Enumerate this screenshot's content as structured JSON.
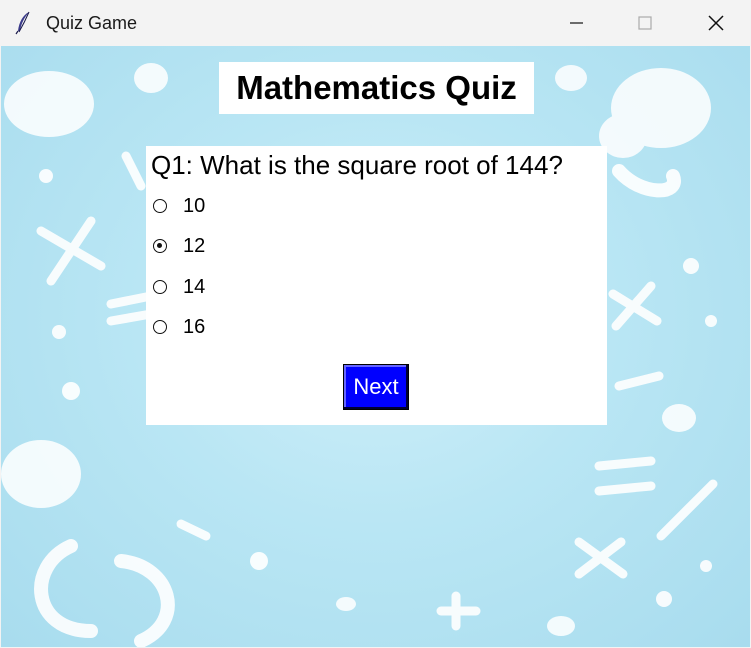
{
  "window": {
    "title": "Quiz Game",
    "app_icon": "feather-icon",
    "controls": [
      "minimize-icon",
      "maximize-icon",
      "close-icon"
    ]
  },
  "quiz": {
    "heading": "Mathematics Quiz",
    "question": "Q1: What is the square root of 144?",
    "options": [
      "10",
      "12",
      "14",
      "16"
    ],
    "selected_option": "12",
    "next_label": "Next"
  },
  "colors": {
    "background_accent": "#b9e6f4",
    "next_button": "#0000ff",
    "next_text": "#ffffff",
    "panel": "#ffffff"
  }
}
